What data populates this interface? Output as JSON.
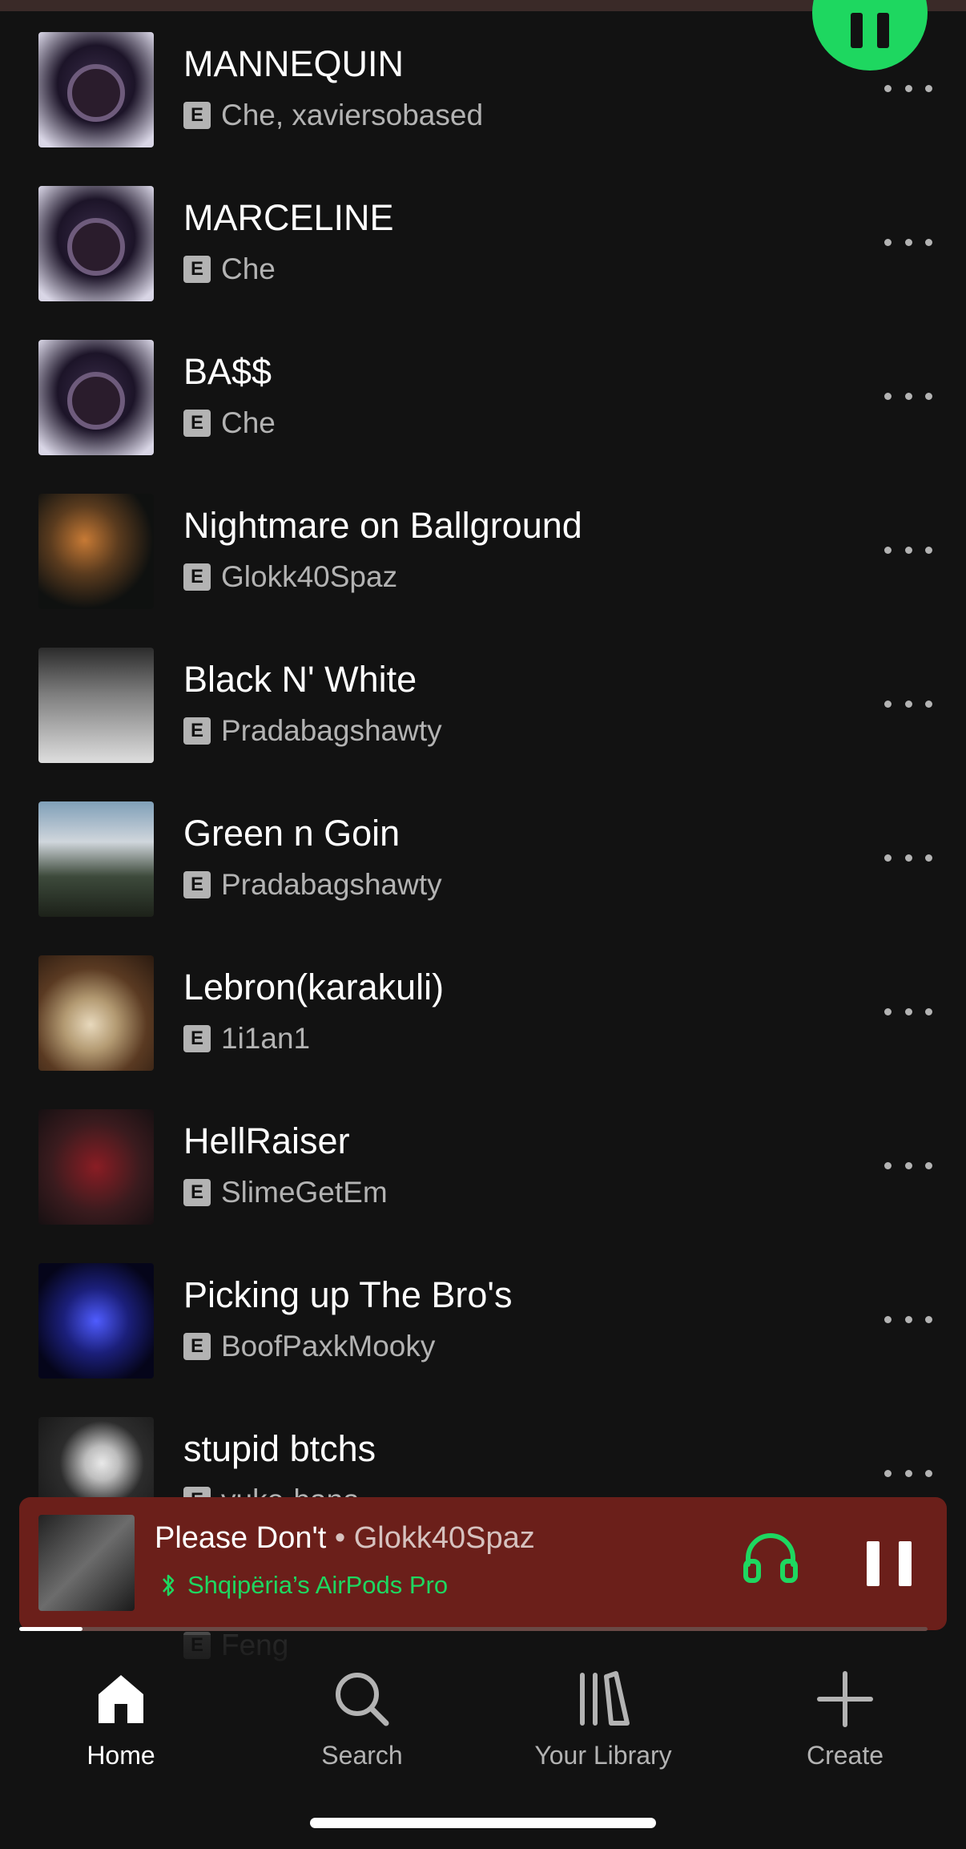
{
  "tracks": [
    {
      "title": "MANNEQUIN",
      "explicit": "E",
      "artist": "Che, xaviersobased",
      "art": "dark-album-art"
    },
    {
      "title": "MARCELINE",
      "explicit": "E",
      "artist": "Che",
      "art": "dark-album-art"
    },
    {
      "title": "BA$$",
      "explicit": "E",
      "artist": "Che",
      "art": "dark-album-art"
    },
    {
      "title": "Nightmare on Ballground",
      "explicit": "E",
      "artist": "Glokk40Spaz",
      "art": "blurred-photo-art"
    },
    {
      "title": "Black N' White",
      "explicit": "E",
      "artist": "Pradabagshawty",
      "art": "black-white-art"
    },
    {
      "title": "Green n Goin",
      "explicit": "E",
      "artist": "Pradabagshawty",
      "art": "landscape-art"
    },
    {
      "title": "Lebron(karakuli)",
      "explicit": "E",
      "artist": "1i1an1",
      "art": "goat-art"
    },
    {
      "title": "HellRaiser",
      "explicit": "E",
      "artist": "SlimeGetEm",
      "art": "red-art"
    },
    {
      "title": "Picking up The Bro's",
      "explicit": "E",
      "artist": "BoofPaxkMooky",
      "art": "blue-neon-art"
    },
    {
      "title": "stupid btchs",
      "explicit": "E",
      "artist": "yuko-bana",
      "art": "cartoon-art"
    }
  ],
  "hidden_next_artist": "Feng",
  "now_playing": {
    "title": "Please Don't",
    "separator": " • ",
    "artist": "Glokk40Spaz",
    "device": "Shqipëria’s AirPods Pro",
    "progress_fraction": 0.07
  },
  "nav": [
    {
      "label": "Home",
      "icon": "home-icon",
      "active": true
    },
    {
      "label": "Search",
      "icon": "search-icon",
      "active": false
    },
    {
      "label": "Your Library",
      "icon": "library-icon",
      "active": false
    },
    {
      "label": "Create",
      "icon": "plus-icon",
      "active": false
    }
  ],
  "colors": {
    "accent": "#1ed760",
    "now_playing_bg": "#6b1f1a",
    "background": "#121212"
  }
}
